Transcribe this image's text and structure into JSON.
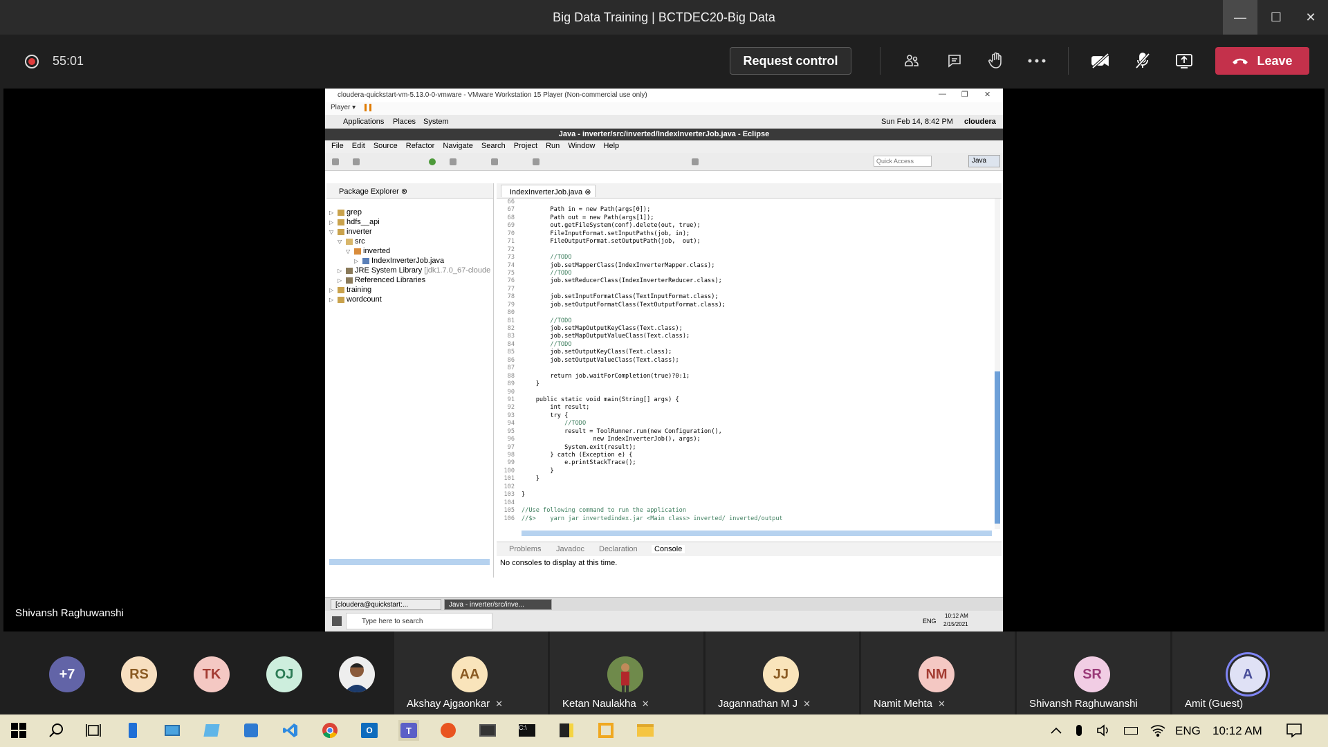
{
  "window": {
    "title": "Big Data Training | BCTDEC20-Big Data"
  },
  "meeting": {
    "timer": "55:01",
    "request_control_label": "Request control",
    "leave_label": "Leave",
    "presenter_name": "Shivansh Raghuwanshi"
  },
  "vm": {
    "title": "cloudera-quickstart-vm-5.13.0-0-vmware - VMware Workstation 15 Player (Non-commercial use only)",
    "player_label": "Player",
    "gnome_menu": [
      "Applications",
      "Places",
      "System"
    ],
    "clock": "Sun Feb 14,  8:42 PM",
    "user": "cloudera"
  },
  "eclipse": {
    "title": "Java - inverter/src/inverted/IndexInverterJob.java - Eclipse",
    "menu": [
      "File",
      "Edit",
      "Source",
      "Refactor",
      "Navigate",
      "Search",
      "Project",
      "Run",
      "Window",
      "Help"
    ],
    "quick_access_placeholder": "Quick Access",
    "perspective": "Java",
    "package_explorer": {
      "tab": "Package Explorer",
      "items": [
        {
          "label": "grep"
        },
        {
          "label": "hdfs__api"
        },
        {
          "label": "inverter"
        },
        {
          "label": "src"
        },
        {
          "label": "inverted"
        },
        {
          "label": "IndexInverterJob.java"
        },
        {
          "label": "JRE System Library",
          "extra": "[jdk1.7.0_67-cloude"
        },
        {
          "label": "Referenced Libraries"
        },
        {
          "label": "training"
        },
        {
          "label": "wordcount"
        }
      ]
    },
    "editor_tab": "IndexInverterJob.java",
    "code_lines": [
      {
        "n": "66",
        "t": ""
      },
      {
        "n": "67",
        "t": "        Path in = new Path(args[0]);"
      },
      {
        "n": "68",
        "t": "        Path out = new Path(args[1]);"
      },
      {
        "n": "69",
        "t": "        out.getFileSystem(conf).delete(out, true);"
      },
      {
        "n": "70",
        "t": "        FileInputFormat.setInputPaths(job, in);"
      },
      {
        "n": "71",
        "t": "        FileOutputFormat.setOutputPath(job,  out);"
      },
      {
        "n": "72",
        "t": ""
      },
      {
        "n": "73",
        "t": "        //TODO"
      },
      {
        "n": "74",
        "t": "        job.setMapperClass(IndexInverterMapper.class);"
      },
      {
        "n": "75",
        "t": "        //TODO"
      },
      {
        "n": "76",
        "t": "        job.setReducerClass(IndexInverterReducer.class);"
      },
      {
        "n": "77",
        "t": ""
      },
      {
        "n": "78",
        "t": "        job.setInputFormatClass(TextInputFormat.class);"
      },
      {
        "n": "79",
        "t": "        job.setOutputFormatClass(TextOutputFormat.class);"
      },
      {
        "n": "80",
        "t": ""
      },
      {
        "n": "81",
        "t": "        //TODO"
      },
      {
        "n": "82",
        "t": "        job.setMapOutputKeyClass(Text.class);"
      },
      {
        "n": "83",
        "t": "        job.setMapOutputValueClass(Text.class);"
      },
      {
        "n": "84",
        "t": "        //TODO"
      },
      {
        "n": "85",
        "t": "        job.setOutputKeyClass(Text.class);"
      },
      {
        "n": "86",
        "t": "        job.setOutputValueClass(Text.class);"
      },
      {
        "n": "87",
        "t": ""
      },
      {
        "n": "88",
        "t": "        return job.waitForCompletion(true)?0:1;"
      },
      {
        "n": "89",
        "t": "    }"
      },
      {
        "n": "90",
        "t": ""
      },
      {
        "n": "91",
        "t": "    public static void main(String[] args) {"
      },
      {
        "n": "92",
        "t": "        int result;"
      },
      {
        "n": "93",
        "t": "        try {"
      },
      {
        "n": "94",
        "t": "            //TODO"
      },
      {
        "n": "95",
        "t": "            result = ToolRunner.run(new Configuration(),"
      },
      {
        "n": "96",
        "t": "                    new IndexInverterJob(), args);"
      },
      {
        "n": "97",
        "t": "            System.exit(result);"
      },
      {
        "n": "98",
        "t": "        } catch (Exception e) {"
      },
      {
        "n": "99",
        "t": "            e.printStackTrace();"
      },
      {
        "n": "100",
        "t": "        }"
      },
      {
        "n": "101",
        "t": "    }"
      },
      {
        "n": "102",
        "t": ""
      },
      {
        "n": "103",
        "t": "}"
      },
      {
        "n": "104",
        "t": ""
      },
      {
        "n": "105",
        "t": "//Use following command to run the application"
      },
      {
        "n": "106",
        "t": "//$>    yarn jar invertedindex.jar <Main class> inverted/ inverted/output"
      }
    ],
    "console_tabs": [
      "Problems",
      "Javadoc",
      "Declaration",
      "Console"
    ],
    "console_message": "No consoles to display at this time."
  },
  "vm_taskbar": {
    "tasks": [
      "[cloudera@quickstart:...",
      "Java - inverter/src/inve..."
    ],
    "search_placeholder": "Type here to search",
    "lang": "ENG",
    "time": "10:12 AM",
    "date": "2/15/2021"
  },
  "participants": {
    "overflow": "+7",
    "avatars": [
      {
        "initials": "RS",
        "bg": "#f7dfc0"
      },
      {
        "initials": "TK",
        "bg": "#f4c8c3"
      },
      {
        "initials": "OJ",
        "bg": "#cdeedd"
      }
    ],
    "tiles": [
      {
        "name": "Akshay Ajgaonkar",
        "initials": "AA",
        "bg": "#f9e4bb",
        "muted": true
      },
      {
        "name": "Ketan Naulakha",
        "initials": "",
        "bg": "#4c6a3d",
        "muted": true
      },
      {
        "name": "Jagannathan M J",
        "initials": "JJ",
        "bg": "#f9e4bb",
        "muted": true
      },
      {
        "name": "Namit Mehta",
        "initials": "NM",
        "bg": "#f4c8c3",
        "muted": true
      },
      {
        "name": "Shivansh Raghuwanshi",
        "initials": "SR",
        "bg": "#f1cde4",
        "muted": false
      },
      {
        "name": "Amit (Guest)",
        "initials": "A",
        "bg": "#dfe1f5",
        "muted": false
      }
    ]
  },
  "taskbar": {
    "lang": "ENG",
    "time": "10:12 AM"
  },
  "colors": {
    "accent_leave": "#c4314b",
    "record": "#e03c3c",
    "teams_ring": "#7f85f5"
  }
}
